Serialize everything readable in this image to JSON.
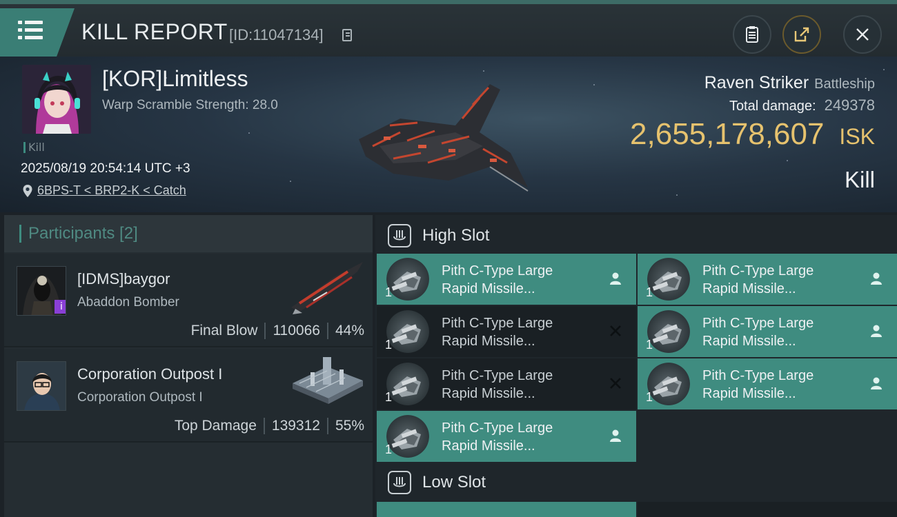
{
  "header": {
    "title": "KILL REPORT",
    "report_id": "[ID:11047134]"
  },
  "victim": {
    "pilot": "[KOR]Limitless",
    "scramble": "Warp Scramble Strength: 28.0",
    "tag": "Kill",
    "datetime": "2025/08/19 20:54:14 UTC +3",
    "location": "6BPS-T < BRP2-K < Catch",
    "ship_name": "Raven Striker",
    "ship_class": "Battleship",
    "damage_label": "Total damage:",
    "damage_value": "249378",
    "isk_value": "2,655,178,607",
    "isk_unit": "ISK",
    "result": "Kill"
  },
  "participants": {
    "title": "Participants [2]",
    "rows": [
      {
        "name": "[IDMS]baygor",
        "ship": "Abaddon Bomber",
        "label": "Final Blow",
        "damage": "110066",
        "pct": "44%"
      },
      {
        "name": "Corporation Outpost I",
        "ship": "Corporation Outpost I",
        "label": "Top Damage",
        "damage": "139312",
        "pct": "55%"
      }
    ]
  },
  "slots": {
    "high_label": "High Slot",
    "low_label": "Low Slot",
    "module_line1": "Pith C-Type Large",
    "module_line2": "Rapid Missile...",
    "qty": "1",
    "high": [
      {
        "state": "fitted"
      },
      {
        "state": "fitted"
      },
      {
        "state": "destroyed"
      },
      {
        "state": "fitted"
      },
      {
        "state": "destroyed"
      },
      {
        "state": "fitted"
      },
      {
        "state": "fitted"
      }
    ]
  },
  "colors": {
    "accent": "#3f8c80",
    "isk": "#e6c26e"
  }
}
